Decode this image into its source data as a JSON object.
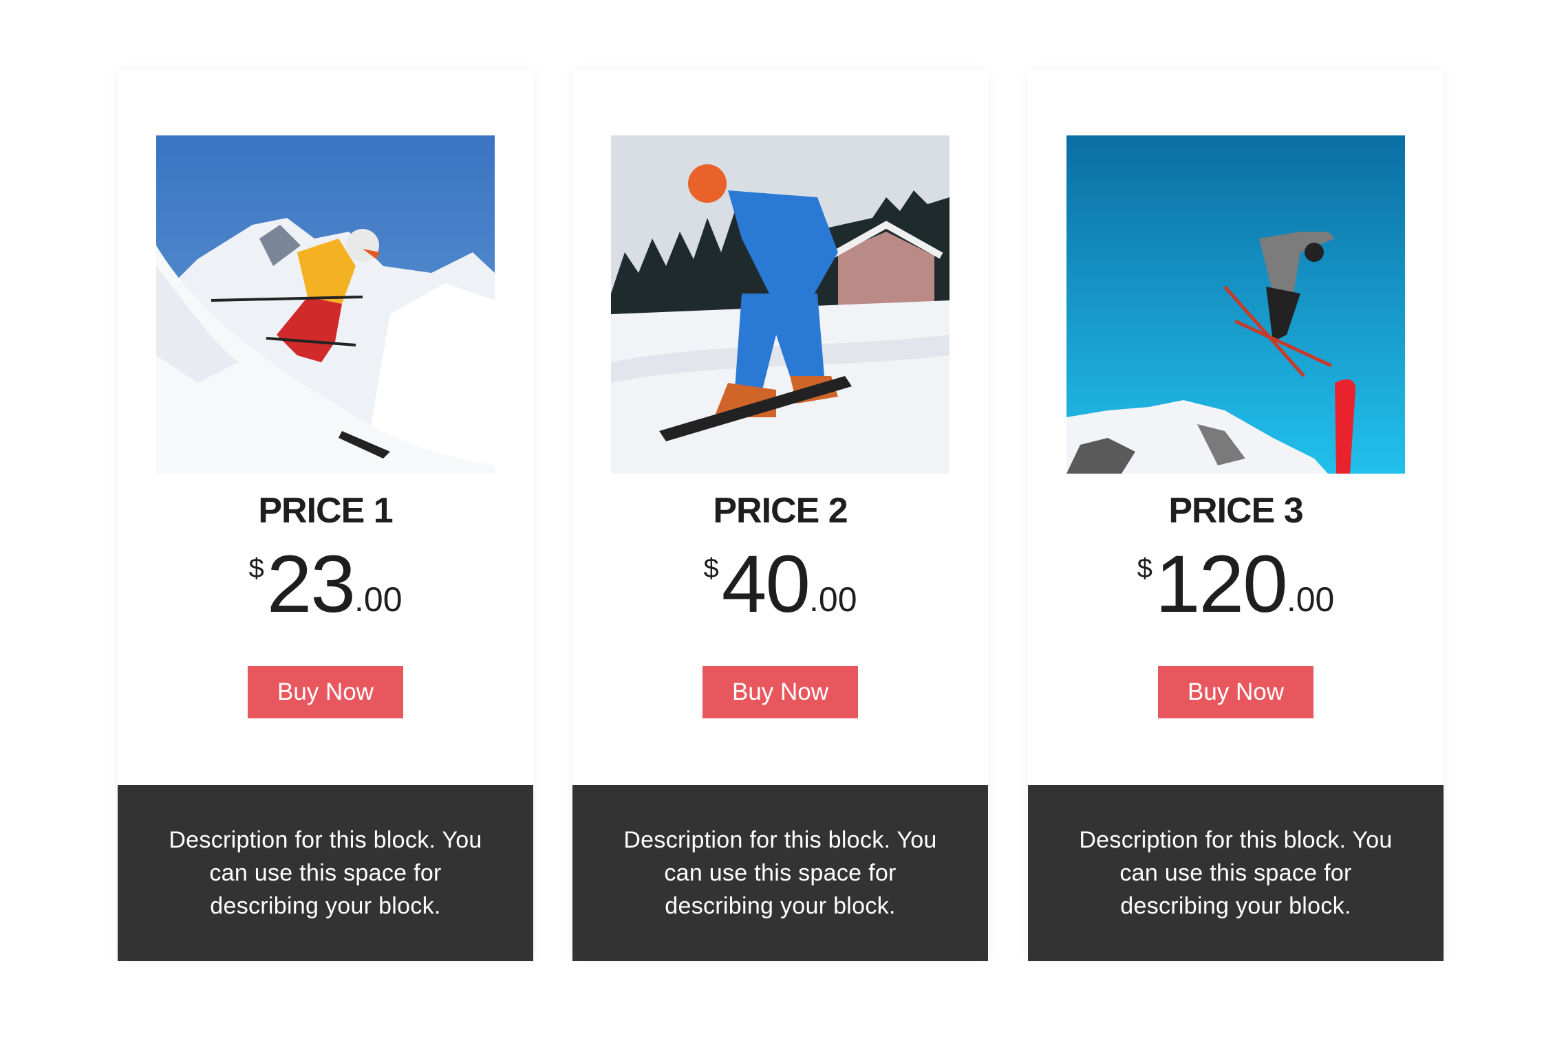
{
  "cards": [
    {
      "image": "skier-downhill-photo",
      "title": "PRICE 1",
      "currency": "$",
      "amount": "23",
      "cents": ".00",
      "button_label": "Buy Now",
      "description": "Description for this block. You can use this space for describing your block."
    },
    {
      "image": "snowboarder-photo",
      "title": "PRICE 2",
      "currency": "$",
      "amount": "40",
      "cents": ".00",
      "button_label": "Buy Now",
      "description": "Description for this block. You can use this space for describing your block."
    },
    {
      "image": "ski-jumper-photo",
      "title": "PRICE 3",
      "currency": "$",
      "amount": "120",
      "cents": ".00",
      "button_label": "Buy Now",
      "description": "Description for this block. You can use this space for describing your block."
    }
  ],
  "colors": {
    "accent": "#e8575d",
    "footer_bg": "#333333",
    "text": "#1e1e1e"
  }
}
